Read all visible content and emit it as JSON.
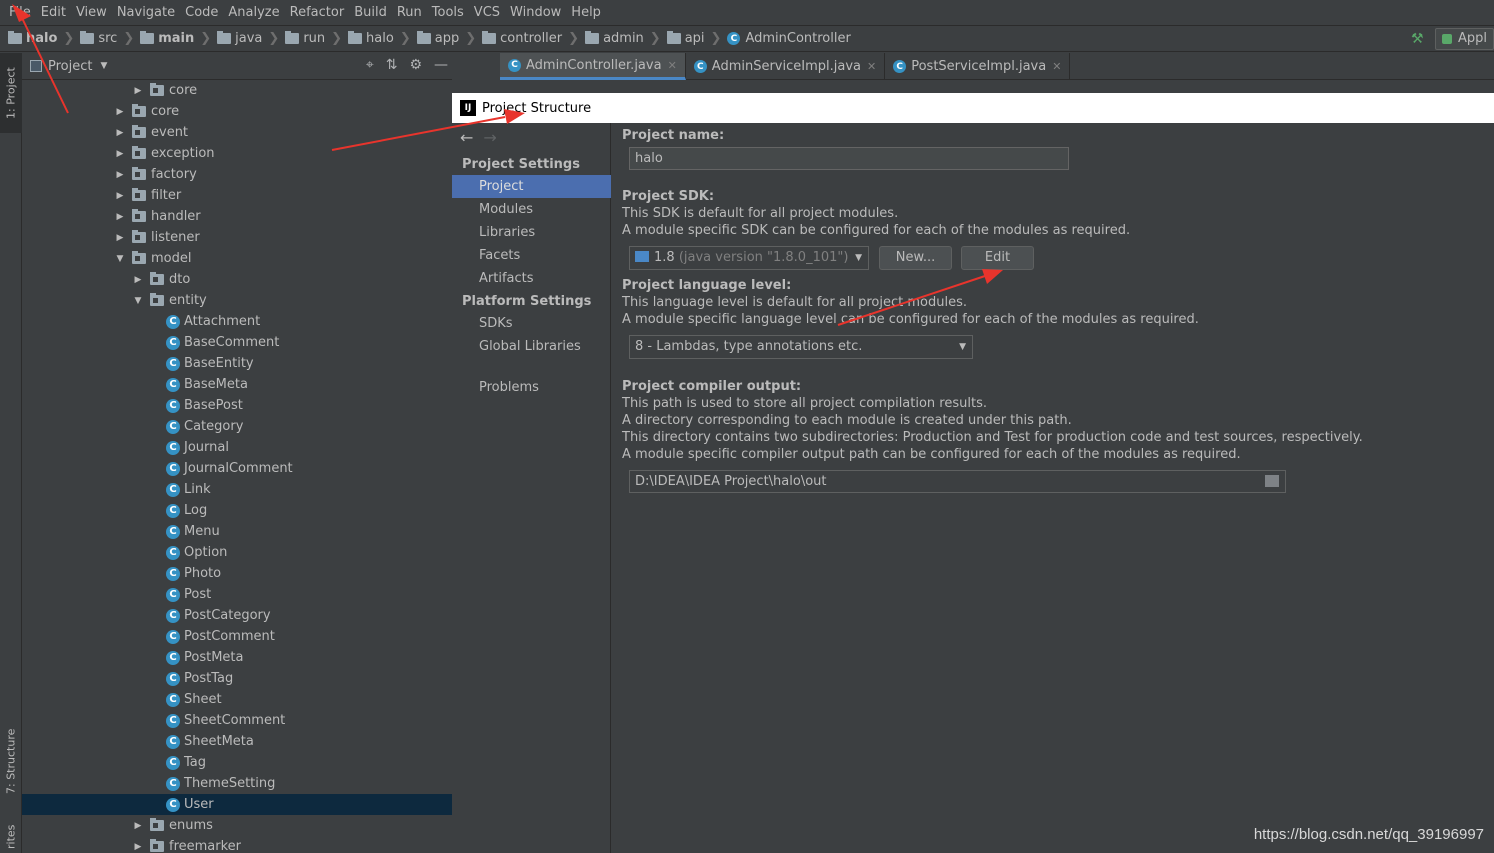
{
  "menu": [
    "File",
    "Edit",
    "View",
    "Navigate",
    "Code",
    "Analyze",
    "Refactor",
    "Build",
    "Run",
    "Tools",
    "VCS",
    "Window",
    "Help"
  ],
  "breadcrumbs": [
    {
      "label": "halo",
      "bold": true
    },
    {
      "label": "src",
      "bold": false
    },
    {
      "label": "main",
      "bold": true
    },
    {
      "label": "java",
      "bold": false
    },
    {
      "label": "run",
      "bold": false
    },
    {
      "label": "halo",
      "bold": false
    },
    {
      "label": "app",
      "bold": false
    },
    {
      "label": "controller",
      "bold": false
    },
    {
      "label": "admin",
      "bold": false
    },
    {
      "label": "api",
      "bold": false
    }
  ],
  "breadcrumb_class": "AdminController",
  "run_config_label": "Appl",
  "tool_windows": {
    "project": "1: Project",
    "structure": "7: Structure",
    "favorites": "rites"
  },
  "project_panel": {
    "title": "Project"
  },
  "tree": [
    {
      "label": "core",
      "kind": "folder",
      "depth": 1,
      "expanded": false
    },
    {
      "label": "core",
      "kind": "folder",
      "depth": 0,
      "expanded": false
    },
    {
      "label": "event",
      "kind": "folder",
      "depth": 0,
      "expanded": false
    },
    {
      "label": "exception",
      "kind": "folder",
      "depth": 0,
      "expanded": false
    },
    {
      "label": "factory",
      "kind": "folder",
      "depth": 0,
      "expanded": false
    },
    {
      "label": "filter",
      "kind": "folder",
      "depth": 0,
      "expanded": false
    },
    {
      "label": "handler",
      "kind": "folder",
      "depth": 0,
      "expanded": false
    },
    {
      "label": "listener",
      "kind": "folder",
      "depth": 0,
      "expanded": false
    },
    {
      "label": "model",
      "kind": "folder",
      "depth": 0,
      "expanded": true
    },
    {
      "label": "dto",
      "kind": "folder",
      "depth": 1,
      "expanded": false
    },
    {
      "label": "entity",
      "kind": "folder",
      "depth": 1,
      "expanded": true
    },
    {
      "label": "Attachment",
      "kind": "class",
      "depth": 2
    },
    {
      "label": "BaseComment",
      "kind": "class",
      "depth": 2
    },
    {
      "label": "BaseEntity",
      "kind": "class",
      "depth": 2
    },
    {
      "label": "BaseMeta",
      "kind": "class",
      "depth": 2
    },
    {
      "label": "BasePost",
      "kind": "class",
      "depth": 2
    },
    {
      "label": "Category",
      "kind": "class",
      "depth": 2
    },
    {
      "label": "Journal",
      "kind": "class",
      "depth": 2
    },
    {
      "label": "JournalComment",
      "kind": "class",
      "depth": 2
    },
    {
      "label": "Link",
      "kind": "class",
      "depth": 2
    },
    {
      "label": "Log",
      "kind": "class",
      "depth": 2
    },
    {
      "label": "Menu",
      "kind": "class",
      "depth": 2
    },
    {
      "label": "Option",
      "kind": "class",
      "depth": 2
    },
    {
      "label": "Photo",
      "kind": "class",
      "depth": 2
    },
    {
      "label": "Post",
      "kind": "class",
      "depth": 2
    },
    {
      "label": "PostCategory",
      "kind": "class",
      "depth": 2
    },
    {
      "label": "PostComment",
      "kind": "class",
      "depth": 2
    },
    {
      "label": "PostMeta",
      "kind": "class",
      "depth": 2
    },
    {
      "label": "PostTag",
      "kind": "class",
      "depth": 2
    },
    {
      "label": "Sheet",
      "kind": "class",
      "depth": 2
    },
    {
      "label": "SheetComment",
      "kind": "class",
      "depth": 2
    },
    {
      "label": "SheetMeta",
      "kind": "class",
      "depth": 2
    },
    {
      "label": "Tag",
      "kind": "class",
      "depth": 2
    },
    {
      "label": "ThemeSetting",
      "kind": "class",
      "depth": 2
    },
    {
      "label": "User",
      "kind": "class",
      "depth": 2,
      "selected": true
    },
    {
      "label": "enums",
      "kind": "folder",
      "depth": 1,
      "expanded": false
    },
    {
      "label": "freemarker",
      "kind": "folder",
      "depth": 1,
      "expanded": false
    }
  ],
  "editor_tabs": [
    {
      "label": "AdminController.java",
      "active": true
    },
    {
      "label": "AdminServiceImpl.java",
      "active": false
    },
    {
      "label": "PostServiceImpl.java",
      "active": false
    }
  ],
  "dialog": {
    "title": "Project Structure",
    "sections": [
      {
        "title": "Project Settings",
        "items": [
          "Project",
          "Modules",
          "Libraries",
          "Facets",
          "Artifacts"
        ]
      },
      {
        "title": "Platform Settings",
        "items": [
          "SDKs",
          "Global Libraries"
        ]
      }
    ],
    "selected_item": "Project",
    "problems": "Problems",
    "project_name_label": "Project name:",
    "project_name_value": "halo",
    "sdk_label": "Project SDK:",
    "sdk_desc1": "This SDK is default for all project modules.",
    "sdk_desc2": "A module specific SDK can be configured for each of the modules as required.",
    "sdk_value": "1.8",
    "sdk_version": "(java version \"1.8.0_101\")",
    "new_button": "New...",
    "edit_button": "Edit",
    "lang_label": "Project language level:",
    "lang_desc1": "This language level is default for all project modules.",
    "lang_desc2": "A module specific language level can be configured for each of the modules as required.",
    "lang_value": "8 - Lambdas, type annotations etc.",
    "out_label": "Project compiler output:",
    "out_desc1": "This path is used to store all project compilation results.",
    "out_desc2": "A directory corresponding to each module is created under this path.",
    "out_desc3": "This directory contains two subdirectories: Production and Test for production code and test sources, respectively.",
    "out_desc4": "A module specific compiler output path can be configured for each of the modules as required.",
    "out_value": "D:\\IDEA\\IDEA Project\\halo\\out"
  },
  "watermark": "https://blog.csdn.net/qq_39196997",
  "colors": {
    "accent": "#4b6eaf",
    "selection": "#0d293e",
    "annotation": "#e8342c"
  }
}
